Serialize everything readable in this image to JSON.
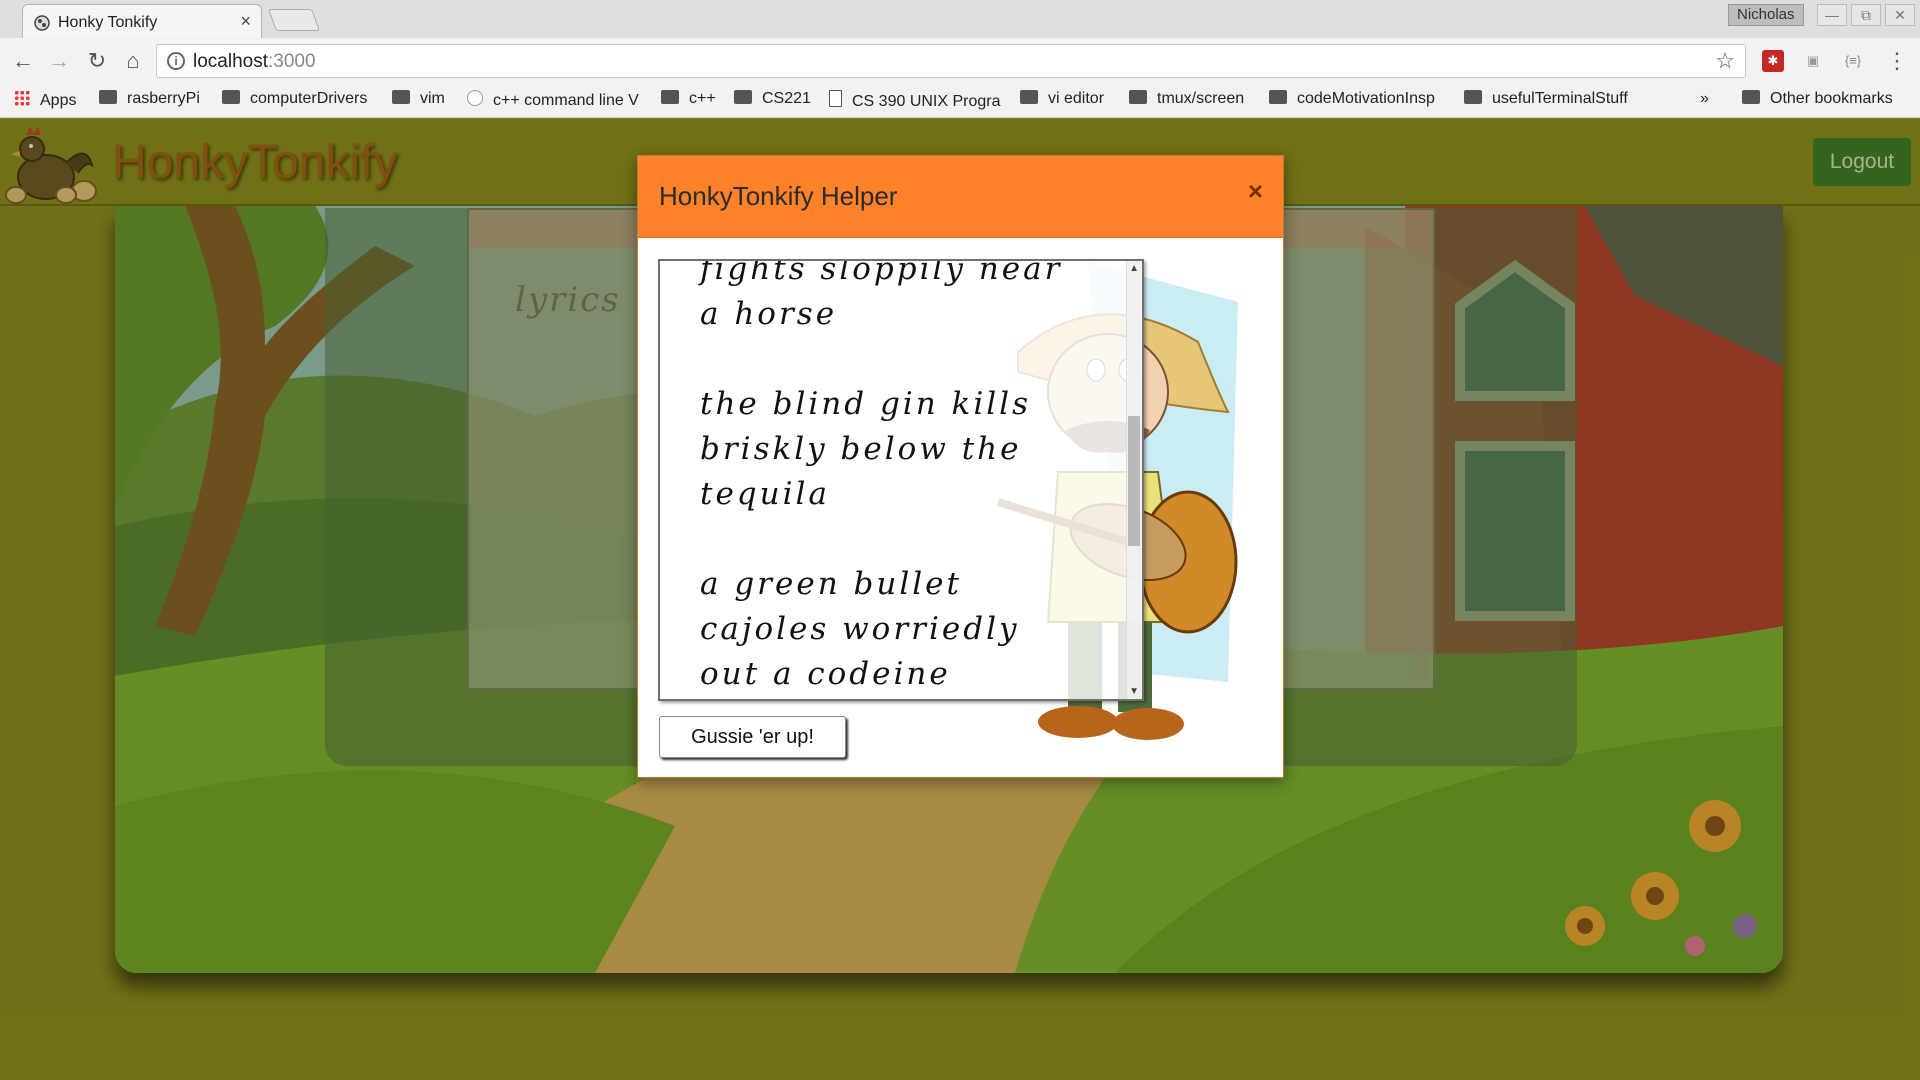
{
  "browser": {
    "tab_title": "Honky Tonkify",
    "tab_close": "×",
    "profile_name": "Nicholas",
    "window_minimize": "—",
    "window_restore": "⧉",
    "window_close": "✕",
    "url_host": "localhost",
    "url_port": ":3000",
    "bookmarks": [
      {
        "label": "Apps",
        "icon": "apps-icon"
      },
      {
        "label": "rasberryPi",
        "icon": "folder-icon"
      },
      {
        "label": "computerDrivers",
        "icon": "folder-icon"
      },
      {
        "label": "vim",
        "icon": "folder-icon"
      },
      {
        "label": "c++ command line V",
        "icon": "globe-icon"
      },
      {
        "label": "c++",
        "icon": "folder-icon"
      },
      {
        "label": "CS221",
        "icon": "folder-icon"
      },
      {
        "label": "CS 390 UNIX Progra",
        "icon": "page-icon"
      },
      {
        "label": "vi editor",
        "icon": "folder-icon"
      },
      {
        "label": "tmux/screen",
        "icon": "folder-icon"
      },
      {
        "label": "codeMotivationInsp",
        "icon": "folder-icon"
      },
      {
        "label": "usefulTerminalStuff",
        "icon": "folder-icon"
      },
      {
        "label": "»",
        "icon": "chevron-icon"
      },
      {
        "label": "Other bookmarks",
        "icon": "folder-icon"
      }
    ]
  },
  "app": {
    "brand": "HonkyTonkify",
    "logout_label": "Logout",
    "lyrics_placeholder": "lyrics"
  },
  "modal": {
    "title": "HonkyTonkify Helper",
    "close_label": "×",
    "output_text": "fights sloppily near\na horse\n\nthe blind gin kills\nbriskly below the\ntequila\n\na green bullet\ncajoles worriedly\nout a codeine",
    "button_label": "Gussie 'er up!"
  },
  "colors": {
    "header_bg": "#7e7e17",
    "brand_text": "#9a4a0c",
    "logout_bg": "#1d6d28",
    "modal_header": "#fe822a"
  }
}
